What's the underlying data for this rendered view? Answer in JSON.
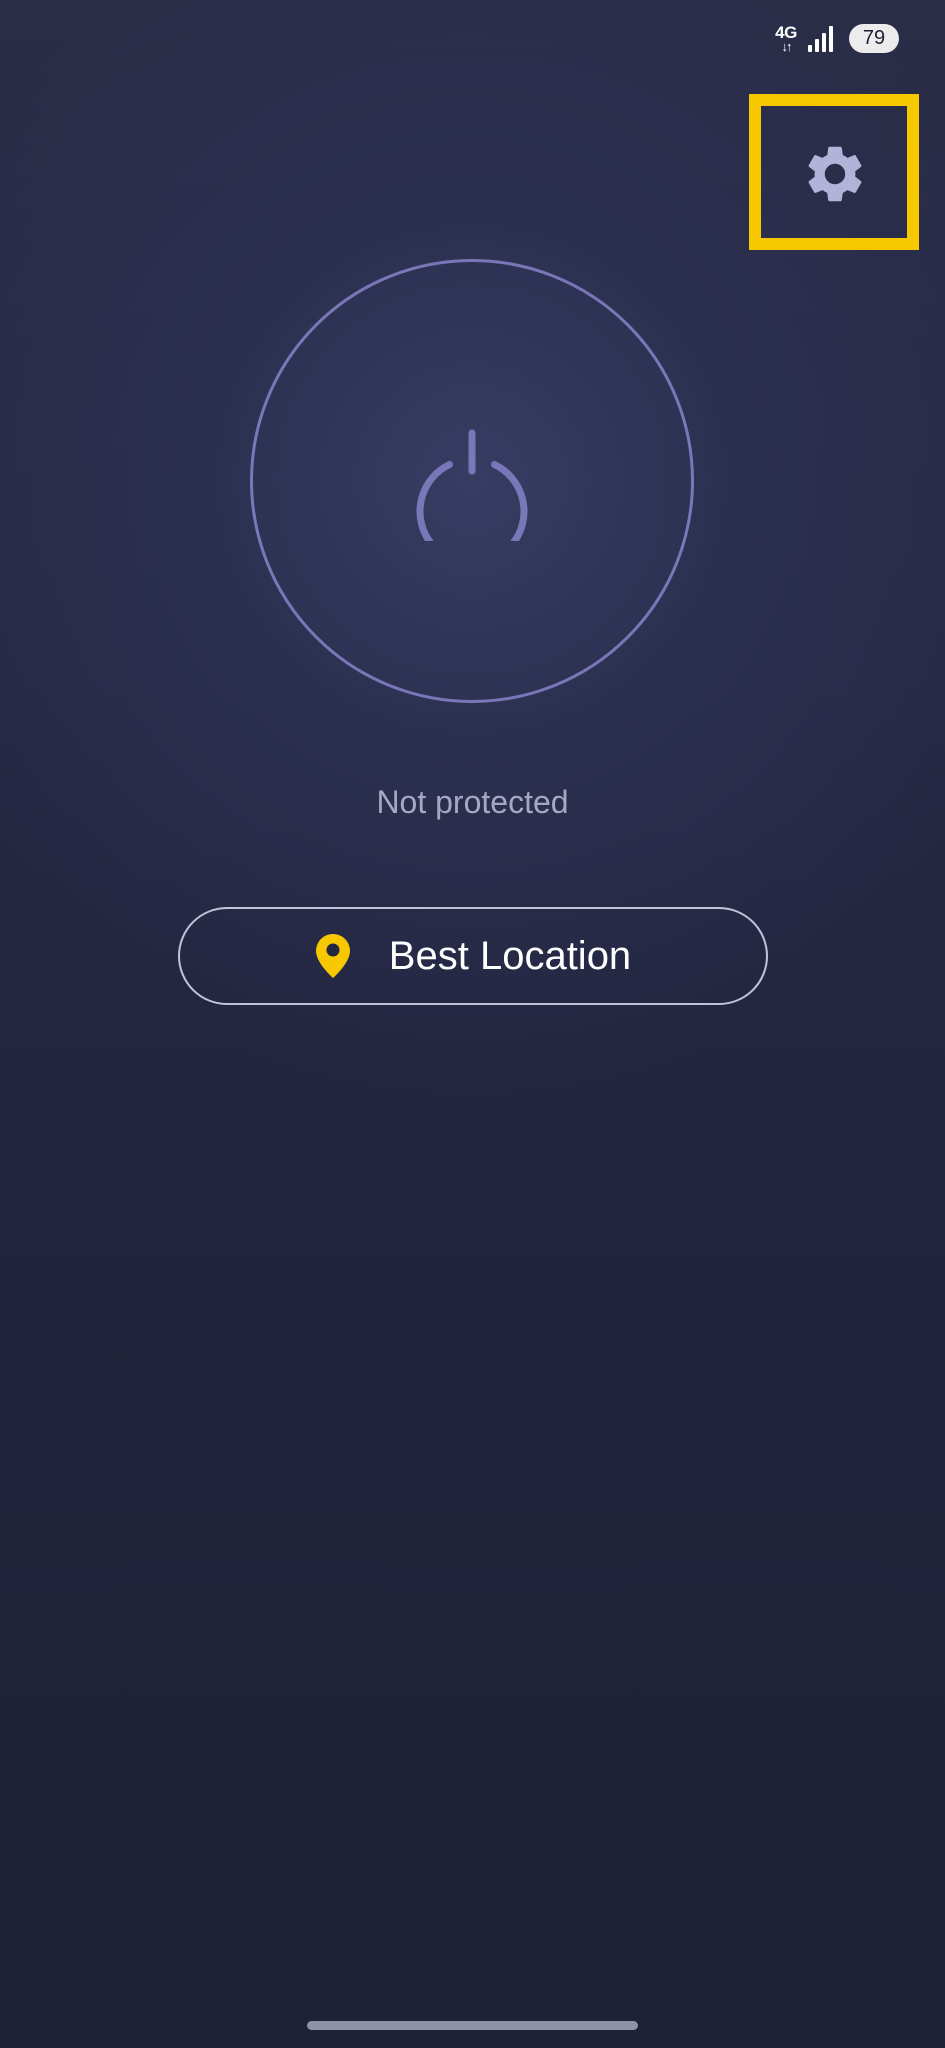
{
  "status_bar": {
    "network_type": "4G",
    "network_arrows": "↓↑",
    "signal_icon": "signal-bars-icon",
    "battery_level": "79"
  },
  "header": {
    "settings_icon": "gear-icon",
    "highlight_color": "#f7c800"
  },
  "main": {
    "power_icon": "power-icon",
    "status_text": "Not protected",
    "location": {
      "icon": "location-pin-icon",
      "icon_color": "#f7c800",
      "label": "Best Location"
    }
  },
  "colors": {
    "ring": "#7a77b9",
    "gear": "#b2b3d8",
    "background": "#232640"
  }
}
